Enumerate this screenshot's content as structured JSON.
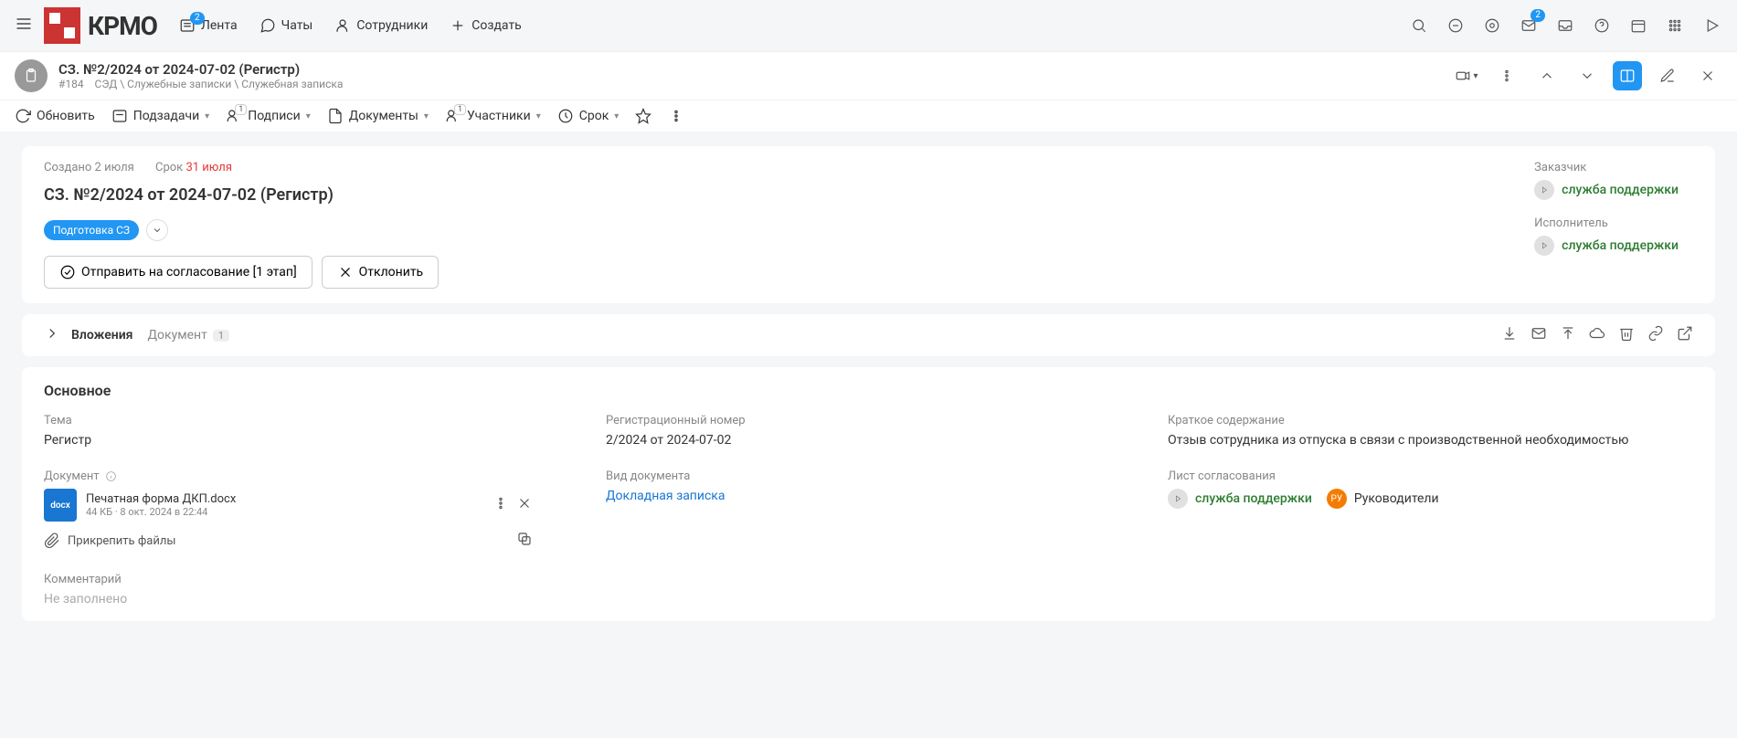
{
  "nav": {
    "logo": "КРМО",
    "feed": "Лента",
    "feed_badge": "2",
    "chats": "Чаты",
    "employees": "Сотрудники",
    "create": "Создать",
    "mail_badge": "2"
  },
  "doc_header": {
    "title": "СЗ. №2/2024 от 2024-07-02 (Регистр)",
    "id": "#184",
    "breadcrumb": "СЭД \\ Служебные записки \\ Служебная записка"
  },
  "toolbar": {
    "refresh": "Обновить",
    "subtasks": "Подзадачи",
    "signatures": "Подписи",
    "signatures_badge": "1",
    "documents": "Документы",
    "participants": "Участники",
    "participants_badge": "1",
    "deadline": "Срок"
  },
  "main": {
    "created_label": "Создано",
    "created_value": "2 июля",
    "deadline_label": "Срок",
    "deadline_value": "31 июля",
    "doc_name": "СЗ. №2/2024 от 2024-07-02 (Регистр)",
    "status": "Подготовка СЗ",
    "action_approve": "Отправить на согласование [1 этап]",
    "action_reject": "Отклонить"
  },
  "side": {
    "customer_label": "Заказчик",
    "customer": "служба поддержки",
    "executor_label": "Исполнитель",
    "executor": "служба поддержки"
  },
  "attachments": {
    "title": "Вложения",
    "tab": "Документ",
    "count": "1"
  },
  "details": {
    "section_title": "Основное",
    "topic_label": "Тема",
    "topic_value": "Регистр",
    "regnum_label": "Регистрационный номер",
    "regnum_value": "2/2024 от 2024-07-02",
    "summary_label": "Краткое содержание",
    "summary_value": "Отзыв сотрудника из отпуска в связи с производственной необходимостью",
    "document_label": "Документ",
    "file_name": "Печатная форма ДКП.docx",
    "file_meta": "44 КБ · 8 окт. 2024 в 22:44",
    "file_ext": "docx",
    "doctype_label": "Вид документа",
    "doctype_value": "Докладная записка",
    "approval_label": "Лист согласования",
    "approval_user1": "служба поддержки",
    "approval_user2": "Руководители",
    "approval_user2_initials": "РУ",
    "attach_files": "Прикрепить файлы",
    "comment_label": "Комментарий",
    "comment_value": "Не заполнено"
  }
}
